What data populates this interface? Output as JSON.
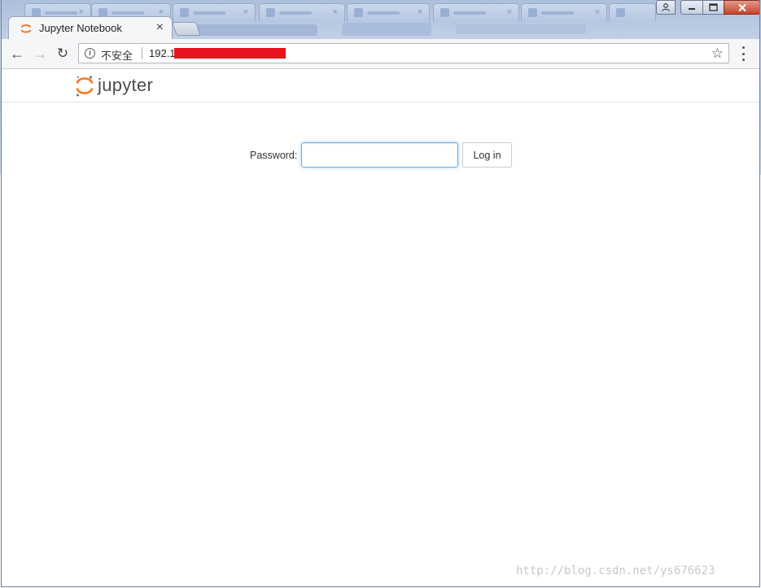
{
  "browser": {
    "active_tab": {
      "title": "Jupyter Notebook",
      "close_glyph": "×"
    },
    "new_tab_icon": "new-tab-icon",
    "window_controls": {
      "user": "👤",
      "minimize": "—",
      "maximize": "□",
      "close": "✕"
    },
    "toolbar": {
      "back_glyph": "←",
      "forward_glyph": "→",
      "reload_glyph": "↻",
      "security_label": "不安全",
      "url": "192.1",
      "star_glyph": "☆"
    }
  },
  "page": {
    "logo_text": "jupyter",
    "login": {
      "password_label": "Password:",
      "password_value": "",
      "login_button": "Log in"
    }
  },
  "watermark": "http://blog.csdn.net/ys676623",
  "colors": {
    "jupyter_orange": "#f37726",
    "input_focus": "#66afe9",
    "redaction": "#e8121d"
  }
}
